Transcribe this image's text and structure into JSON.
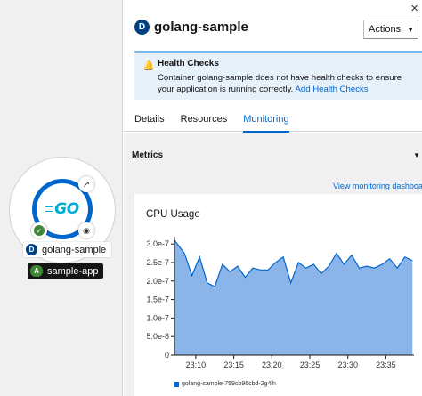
{
  "node": {
    "name": "golang-sample",
    "kind_badge": "D",
    "app_badge": "A",
    "app_name": "sample-app",
    "logo_text": "GO"
  },
  "panel": {
    "kind_badge": "D",
    "title": "golang-sample",
    "actions_label": "Actions",
    "close_glyph": "×"
  },
  "alert": {
    "title": "Health Checks",
    "body": "Container golang-sample does not have health checks to ensure your application is running correctly.",
    "link": "Add Health Checks"
  },
  "tabs": [
    {
      "label": "Details",
      "active": false
    },
    {
      "label": "Resources",
      "active": false
    },
    {
      "label": "Monitoring",
      "active": true
    }
  ],
  "metrics": {
    "section_label": "Metrics",
    "view_link": "View monitoring dashboard"
  },
  "chart_data": {
    "type": "area",
    "title": "CPU Usage",
    "xlabel": "",
    "ylabel": "",
    "yticks": [
      "3.0e-7",
      "2.5e-7",
      "2.0e-7",
      "1.5e-7",
      "1.0e-7",
      "5.0e-8",
      "0"
    ],
    "ytick_values": [
      3e-07,
      2.5e-07,
      2e-07,
      1.5e-07,
      1e-07,
      5e-08,
      0
    ],
    "ylim": [
      0,
      3.1e-07
    ],
    "xticks": [
      "23:10",
      "23:15",
      "23:20",
      "23:25",
      "23:30",
      "23:35"
    ],
    "xtick_minutes": [
      10,
      15,
      20,
      25,
      30,
      35
    ],
    "xlim_minutes": [
      7.2,
      38.7
    ],
    "series": [
      {
        "name": "golang-sample-759cb96cbd-2g4lh",
        "x_minutes": [
          7.2,
          8.5,
          9.5,
          10.5,
          11.5,
          12.5,
          13.5,
          14.5,
          15.5,
          16.5,
          17.5,
          18.5,
          19.5,
          20.5,
          21.5,
          22.5,
          23.5,
          24.5,
          25.5,
          26.5,
          27.5,
          28.5,
          29.5,
          30.5,
          31.5,
          32.5,
          33.5,
          34.5,
          35.5,
          36.5,
          37.5,
          38.5
        ],
        "values": [
          3.1e-07,
          2.75e-07,
          2.15e-07,
          2.65e-07,
          1.95e-07,
          1.85e-07,
          2.45e-07,
          2.25e-07,
          2.4e-07,
          2.1e-07,
          2.35e-07,
          2.3e-07,
          2.3e-07,
          2.5e-07,
          2.65e-07,
          1.95e-07,
          2.5e-07,
          2.35e-07,
          2.45e-07,
          2.2e-07,
          2.4e-07,
          2.75e-07,
          2.45e-07,
          2.7e-07,
          2.35e-07,
          2.4e-07,
          2.35e-07,
          2.45e-07,
          2.6e-07,
          2.35e-07,
          2.65e-07,
          2.55e-07
        ]
      }
    ],
    "grid": false,
    "legend": "bottom-left",
    "colors": {
      "fill": "#8bb5e8",
      "line": "#06c"
    }
  }
}
